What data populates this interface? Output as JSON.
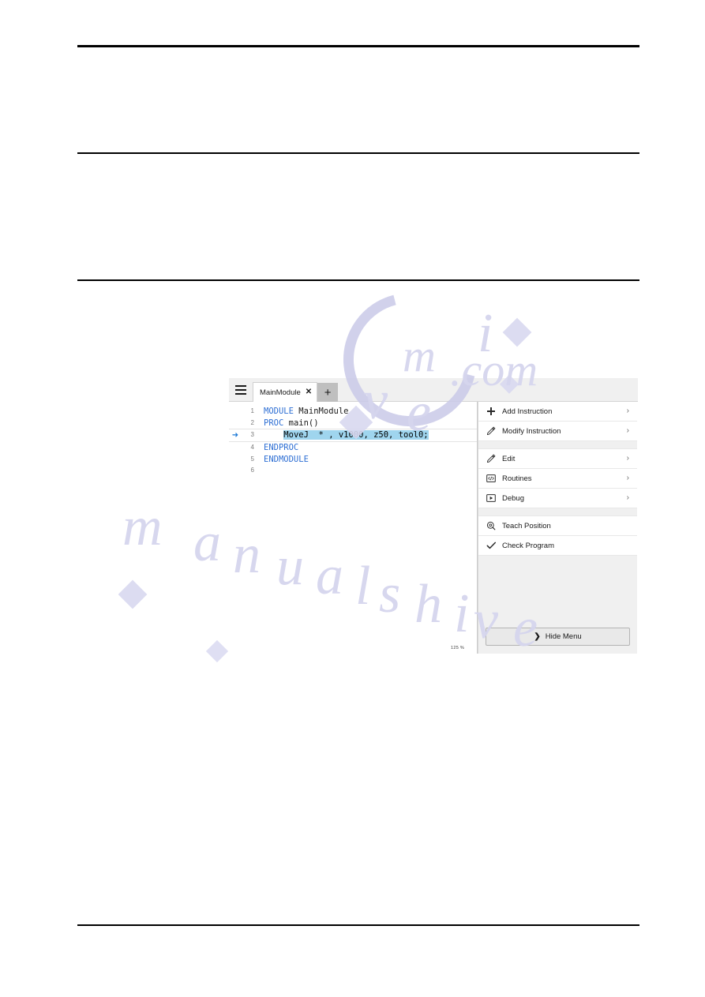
{
  "app": {
    "tabs": [
      {
        "label": "MainModule",
        "close_glyph": "✕",
        "name": "tab-mainmodule"
      }
    ],
    "add_tab_glyph": "+",
    "hamburger_name": "hamburger-menu-icon",
    "editor": {
      "zoom_level": "125 %",
      "lines": [
        {
          "number": "1",
          "marker": "",
          "segments": [
            {
              "text": "MODULE",
              "style": "kw"
            },
            {
              "text": " MainModule",
              "style": "plain"
            }
          ]
        },
        {
          "number": "2",
          "marker": "",
          "segments": [
            {
              "text": "PROC",
              "style": "kw"
            },
            {
              "text": " main()",
              "style": "plain"
            }
          ]
        },
        {
          "number": "3",
          "marker": "➜",
          "current": true,
          "segments": [
            {
              "text": "    ",
              "style": "plain"
            },
            {
              "text": "MoveJ  * , v1000, z50, tool0;",
              "style": "sel"
            }
          ]
        },
        {
          "number": "4",
          "marker": "",
          "segments": [
            {
              "text": "ENDPROC",
              "style": "kw"
            }
          ]
        },
        {
          "number": "5",
          "marker": "",
          "segments": [
            {
              "text": "ENDMODULE",
              "style": "kw"
            }
          ]
        },
        {
          "number": "6",
          "marker": "",
          "segments": [
            {
              "text": "",
              "style": "plain"
            }
          ]
        }
      ]
    },
    "menu": {
      "groups": [
        {
          "items": [
            {
              "label": "Add Instruction",
              "icon": "plus-icon",
              "chevron": "›"
            },
            {
              "label": "Modify Instruction",
              "icon": "pencil-icon",
              "chevron": "›"
            }
          ]
        },
        {
          "items": [
            {
              "label": "Edit",
              "icon": "pencil-icon",
              "chevron": "›"
            },
            {
              "label": "Routines",
              "icon": "code-box-icon",
              "chevron": "›"
            },
            {
              "label": "Debug",
              "icon": "play-box-icon",
              "chevron": "›"
            }
          ]
        },
        {
          "items": [
            {
              "label": "Teach Position",
              "icon": "target-position-icon",
              "chevron": ""
            },
            {
              "label": "Check Program",
              "icon": "checkmark-icon",
              "chevron": ""
            }
          ]
        }
      ],
      "hide_menu_label": "Hide Menu",
      "hide_menu_chevron": "❯"
    }
  },
  "colors": {
    "keyword_blue": "#2e6fd4",
    "selection_blue": "#9fd5ee",
    "arrow_blue": "#1e7ad6",
    "panel_gray": "#f0f0f0",
    "active_tab_gray": "#bfbfbf"
  }
}
